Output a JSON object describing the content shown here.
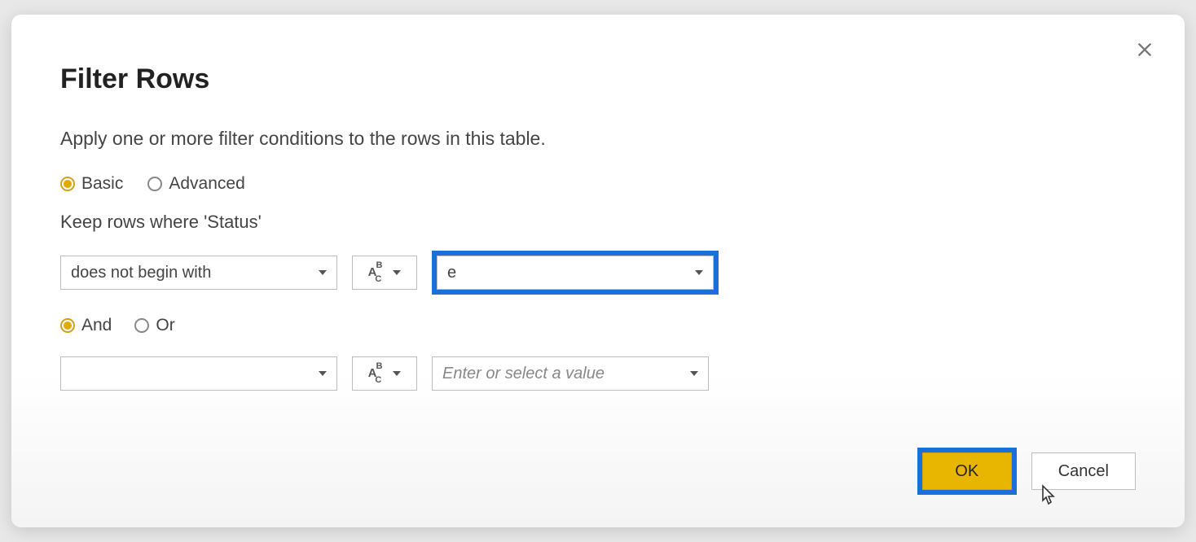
{
  "dialog": {
    "title": "Filter Rows",
    "subtitle": "Apply one or more filter conditions to the rows in this table.",
    "mode": {
      "basic": "Basic",
      "advanced": "Advanced"
    },
    "keep_rows_label": "Keep rows where 'Status'",
    "condition1": {
      "operator": "does not begin with",
      "value": "e"
    },
    "logic": {
      "and": "And",
      "or": "Or"
    },
    "condition2": {
      "operator": "",
      "placeholder": "Enter or select a value"
    },
    "buttons": {
      "ok": "OK",
      "cancel": "Cancel"
    }
  }
}
